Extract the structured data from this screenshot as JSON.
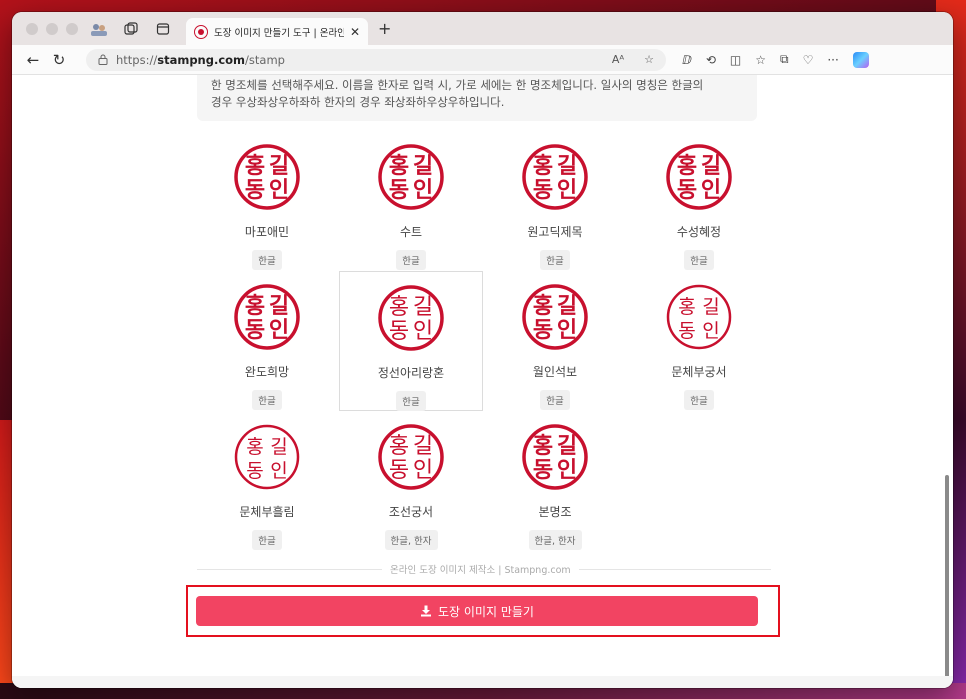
{
  "browser": {
    "tab_title": "도장 이미지 만들기 도구 | 온라인 도장",
    "url_protocol": "https://",
    "url_domain": "stampng.com",
    "url_path": "/stamp",
    "reader_icon": "Aᴬ",
    "star_icon": "☆",
    "more_icon": "···"
  },
  "intro": {
    "line1": "한 명조체를 선택해주세요. 이름을 한자로 입력 시, 가로 세에는 한 명조체입니다. 일사의 명칭은 한글의",
    "line2": "경우 우상좌상우하좌하 한자의 경우 좌상좌하우상우하입니다."
  },
  "seals": [
    {
      "name": "마포애민",
      "tag": "한글",
      "chars": [
        "홍",
        "길",
        "동",
        "인"
      ],
      "weight": "bold",
      "style": "round"
    },
    {
      "name": "수트",
      "tag": "한글",
      "chars": [
        "홍",
        "길",
        "동",
        "인"
      ],
      "weight": "bold",
      "style": "normal"
    },
    {
      "name": "원고딕제목",
      "tag": "한글",
      "chars": [
        "홍",
        "길",
        "동",
        "인"
      ],
      "weight": "bold",
      "style": "normal"
    },
    {
      "name": "수성혜정",
      "tag": "한글",
      "chars": [
        "홍",
        "길",
        "동",
        "인"
      ],
      "weight": "bold",
      "style": "normal"
    },
    {
      "name": "완도희망",
      "tag": "한글",
      "chars": [
        "홍",
        "길",
        "동",
        "인"
      ],
      "weight": "bold",
      "style": "normal"
    },
    {
      "name": "정선아리랑혼",
      "tag": "한글",
      "chars": [
        "홍",
        "길",
        "동",
        "인"
      ],
      "weight": "normal",
      "style": "normal"
    },
    {
      "name": "월인석보",
      "tag": "한글",
      "chars": [
        "홍",
        "길",
        "동",
        "인"
      ],
      "weight": "bold",
      "style": "normal"
    },
    {
      "name": "문체부궁서",
      "tag": "한글",
      "chars": [
        "홍",
        "길",
        "동",
        "인"
      ],
      "weight": "normal",
      "style": "light"
    },
    {
      "name": "문체부흘림",
      "tag": "한글",
      "chars": [
        "홍",
        "길",
        "동",
        "인"
      ],
      "weight": "normal",
      "style": "light"
    },
    {
      "name": "조선궁서",
      "tag": "한글, 한자",
      "chars": [
        "홍",
        "길",
        "동",
        "인"
      ],
      "weight": "normal",
      "style": "normal"
    },
    {
      "name": "본명조",
      "tag": "한글, 한자",
      "chars": [
        "홍",
        "길",
        "동",
        "인"
      ],
      "weight": "bold",
      "style": "normal"
    }
  ],
  "selected_index": 5,
  "footer_text": "온라인 도장 이미지 제작소 | Stampng.com",
  "cta_label": "도장 이미지 만들기",
  "colors": {
    "seal_red": "#c8102e",
    "cta_pink": "#f24462",
    "highlight_red": "#e4101e"
  },
  "icons": {
    "download": "download-icon",
    "back": "back-arrow-icon",
    "refresh": "refresh-icon",
    "lock": "lock-icon"
  }
}
